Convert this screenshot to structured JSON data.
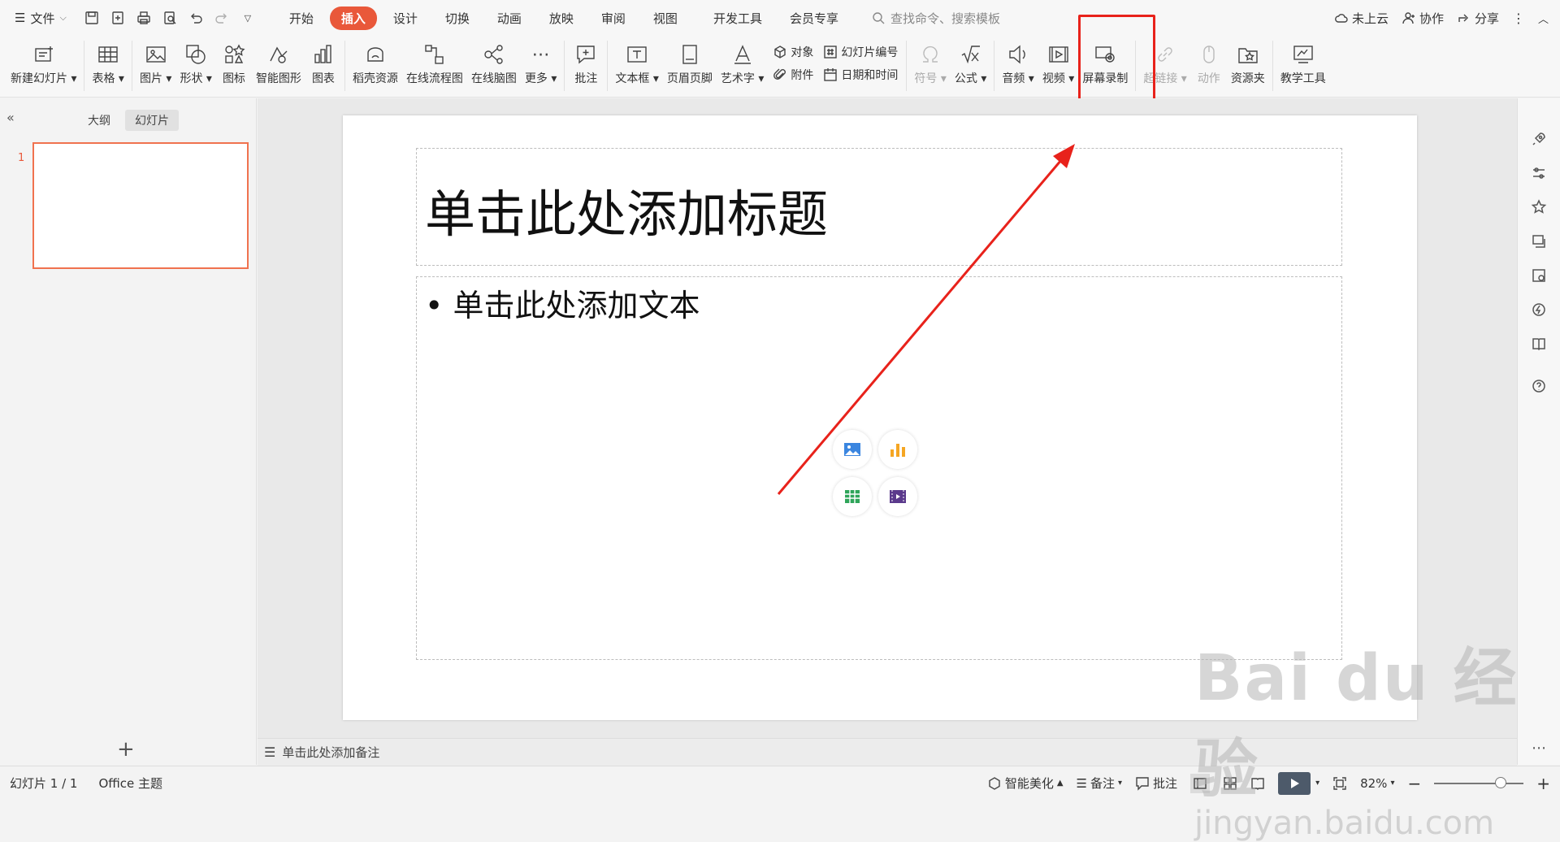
{
  "menubar": {
    "file_label": "文件",
    "tabs": [
      "开始",
      "插入",
      "设计",
      "切换",
      "动画",
      "放映",
      "审阅",
      "视图",
      "开发工具",
      "会员专享"
    ],
    "active_tab": "插入",
    "search_placeholder": "查找命令、搜索模板",
    "cloud_label": "未上云",
    "collab_label": "协作",
    "share_label": "分享"
  },
  "ribbon": {
    "new_slide": "新建幻灯片",
    "table": "表格",
    "picture": "图片",
    "shape": "形状",
    "icon": "图标",
    "smartart": "智能图形",
    "chart": "图表",
    "resources": "稻壳资源",
    "flowchart": "在线流程图",
    "mindmap": "在线脑图",
    "more": "更多",
    "comment": "批注",
    "textbox": "文本框",
    "header_footer": "页眉页脚",
    "wordart": "艺术字",
    "object": "对象",
    "attachment": "附件",
    "slide_number": "幻灯片编号",
    "datetime": "日期和时间",
    "symbol": "符号",
    "formula": "公式",
    "audio": "音频",
    "video": "视频",
    "screen_record": "屏幕录制",
    "hyperlink": "超链接",
    "action": "动作",
    "resource_folder": "资源夹",
    "teaching_tools": "教学工具"
  },
  "leftpanel": {
    "outline_tab": "大纲",
    "slides_tab": "幻灯片",
    "slide_number": "1"
  },
  "slide": {
    "title_placeholder": "单击此处添加标题",
    "body_placeholder": "• 单击此处添加文本"
  },
  "notes": {
    "placeholder": "单击此处添加备注"
  },
  "statusbar": {
    "slide_count": "幻灯片 1 / 1",
    "theme": "Office 主题",
    "beautify": "智能美化",
    "notes": "备注",
    "comments": "批注",
    "zoom": "82%"
  },
  "watermark": {
    "brand": "Bai du 经验",
    "url": "jingyan.baidu.com"
  },
  "colors": {
    "accent": "#e9583a",
    "highlight": "#e8221b"
  }
}
